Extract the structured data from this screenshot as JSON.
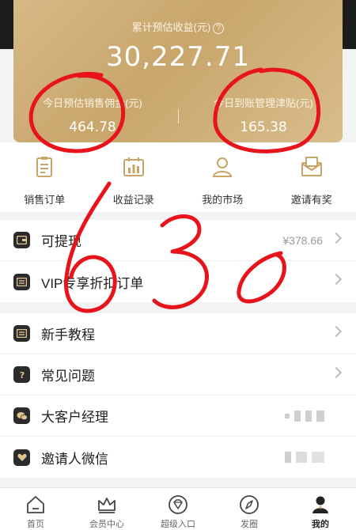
{
  "card": {
    "title": "累计预估收益(元)",
    "total": "30,227.71",
    "left_label": "今日预估销售佣金(元)",
    "left_value": "464.78",
    "right_label": "今日到账管理津贴(元)",
    "right_value": "165.38"
  },
  "quick": [
    {
      "label": "销售订单",
      "icon": "clipboard-icon"
    },
    {
      "label": "收益记录",
      "icon": "bar-chart-icon"
    },
    {
      "label": "我的市场",
      "icon": "person-icon"
    },
    {
      "label": "邀请有奖",
      "icon": "envelope-icon"
    }
  ],
  "menu1": [
    {
      "label": "可提现",
      "value": "¥378.66"
    },
    {
      "label": "VIP专享折扣订单"
    }
  ],
  "menu2": [
    {
      "label": "新手教程"
    },
    {
      "label": "常见问题"
    },
    {
      "label": "大客户经理"
    },
    {
      "label": "邀请人微信"
    }
  ],
  "tabs": [
    {
      "label": "首页"
    },
    {
      "label": "会员中心"
    },
    {
      "label": "超级入口"
    },
    {
      "label": "发圈"
    },
    {
      "label": "我的"
    }
  ],
  "handwriting": {
    "text": "630",
    "color": "#e8141b"
  },
  "colors": {
    "gold": "#d2b27a",
    "dark": "#1c1c1c",
    "ink": "#e8141b"
  }
}
